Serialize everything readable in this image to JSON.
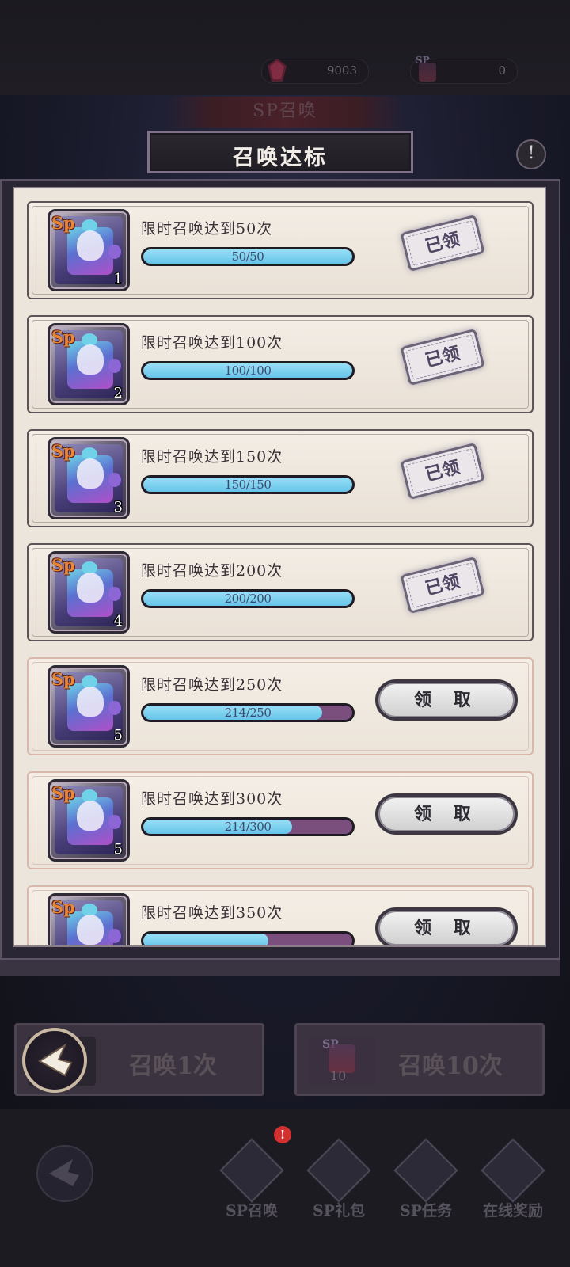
{
  "currencies": [
    {
      "icon": "gem-icon",
      "value": "9003"
    },
    {
      "icon": "sp-ticket-icon",
      "label": "SP",
      "value": "0"
    }
  ],
  "scene_title": "SP召唤",
  "panel_title": "召唤达标",
  "info_icon": "!",
  "rewards": [
    {
      "label": "限时召唤达到50次",
      "progress": "50/50",
      "fraction": 1.0,
      "qty": "1",
      "status": "已领",
      "claimed": true
    },
    {
      "label": "限时召唤达到100次",
      "progress": "100/100",
      "fraction": 1.0,
      "qty": "2",
      "status": "已领",
      "claimed": true
    },
    {
      "label": "限时召唤达到150次",
      "progress": "150/150",
      "fraction": 1.0,
      "qty": "3",
      "status": "已领",
      "claimed": true
    },
    {
      "label": "限时召唤达到200次",
      "progress": "200/200",
      "fraction": 1.0,
      "qty": "4",
      "status": "已领",
      "claimed": true
    },
    {
      "label": "限时召唤达到250次",
      "progress": "214/250",
      "fraction": 0.856,
      "qty": "5",
      "status": "领 取",
      "claimed": false
    },
    {
      "label": "限时召唤达到300次",
      "progress": "214/300",
      "fraction": 0.713,
      "qty": "5",
      "status": "领 取",
      "claimed": false
    },
    {
      "label": "限时召唤达到350次",
      "progress": "",
      "fraction": 0.6,
      "qty": "",
      "status": "领 取",
      "claimed": false
    }
  ],
  "sp_tag": "Sp",
  "summon_one": "召唤1次",
  "summon_ten": "召唤10次",
  "summon_ten_token": {
    "label": "SP",
    "count": "10"
  },
  "nav": [
    {
      "label": "SP召唤",
      "icon": "sp-summon-icon"
    },
    {
      "label": "SP礼包",
      "icon": "sp-gift-icon"
    },
    {
      "label": "SP任务",
      "icon": "sp-task-icon"
    },
    {
      "label": "在线奖励",
      "icon": "online-reward-icon"
    }
  ],
  "nav_badge": "!",
  "colors": {
    "progress_fill": "#66c4e8",
    "progress_track": "#7a4f7e",
    "panel_bg": "#ece5dc",
    "badge": "#d43030"
  }
}
